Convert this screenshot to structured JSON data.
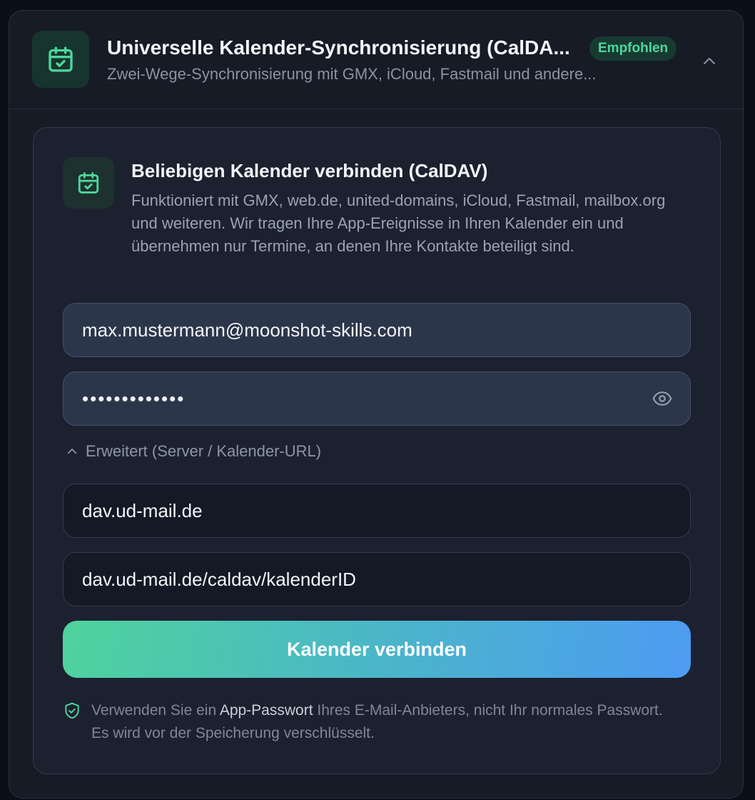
{
  "header": {
    "title": "Universelle Kalender-Synchronisierung (CalDA...",
    "badge": "Empfohlen",
    "subtitle": "Zwei-Wege-Synchronisierung mit GMX, iCloud, Fastmail und andere...",
    "icon": "calendar-check-icon",
    "collapse_icon": "chevron-up-icon"
  },
  "panel": {
    "title": "Beliebigen Kalender verbinden (CalDAV)",
    "description": "Funktioniert mit GMX, web.de, united-domains, iCloud, Fastmail, mailbox.org und weiteren. Wir tragen Ihre App-Ereignisse in Ihren Kalender ein und übernehmen nur Termine, an denen Ihre Kontakte beteiligt sind.",
    "icon": "calendar-check-icon"
  },
  "form": {
    "email_value": "max.mustermann@moonshot-skills.com",
    "password_value": "•••••••••••••",
    "advanced_label": "Erweitert (Server / Kalender-URL)",
    "server_value": "dav.ud-mail.de",
    "calendar_url_value": "dav.ud-mail.de/caldav/kalenderID",
    "submit_label": "Kalender verbinden"
  },
  "note": {
    "prefix": "Verwenden Sie ein ",
    "highlight": "App-Passwort",
    "suffix": " Ihres E-Mail-Anbieters, nicht Ihr normales Passwort. Es wird vor der Speicherung verschlüsselt.",
    "icon": "shield-check-icon"
  },
  "colors": {
    "accent_green": "#4fd69c",
    "accent_blue": "#4d9bf2",
    "background": "#0b0f18",
    "card": "#161b26"
  }
}
